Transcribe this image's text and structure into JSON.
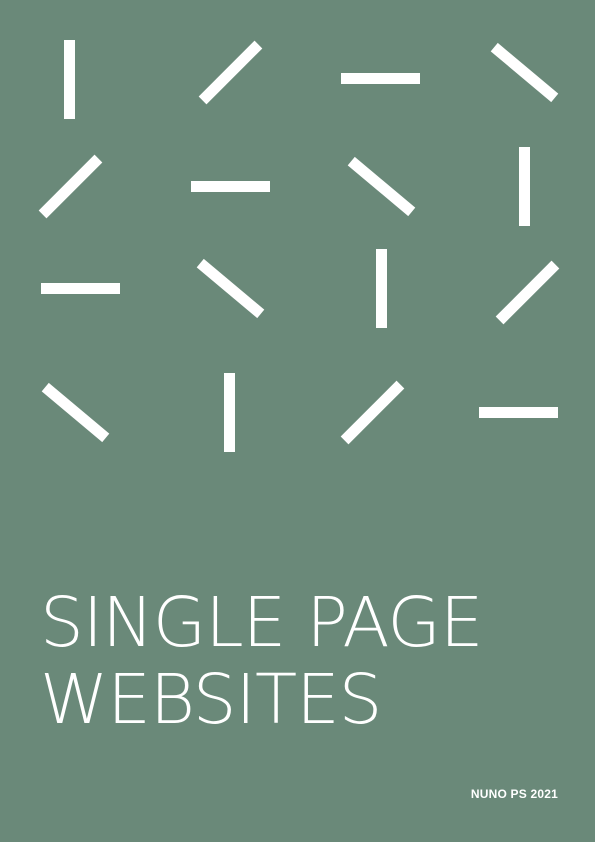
{
  "cover": {
    "background_color": "#6a8979",
    "foreground_color": "#ffffff",
    "title_line_1": "SINGLE PAGE",
    "title_line_2": "WEBSITES",
    "credit": "NUNO PS 2021"
  }
}
